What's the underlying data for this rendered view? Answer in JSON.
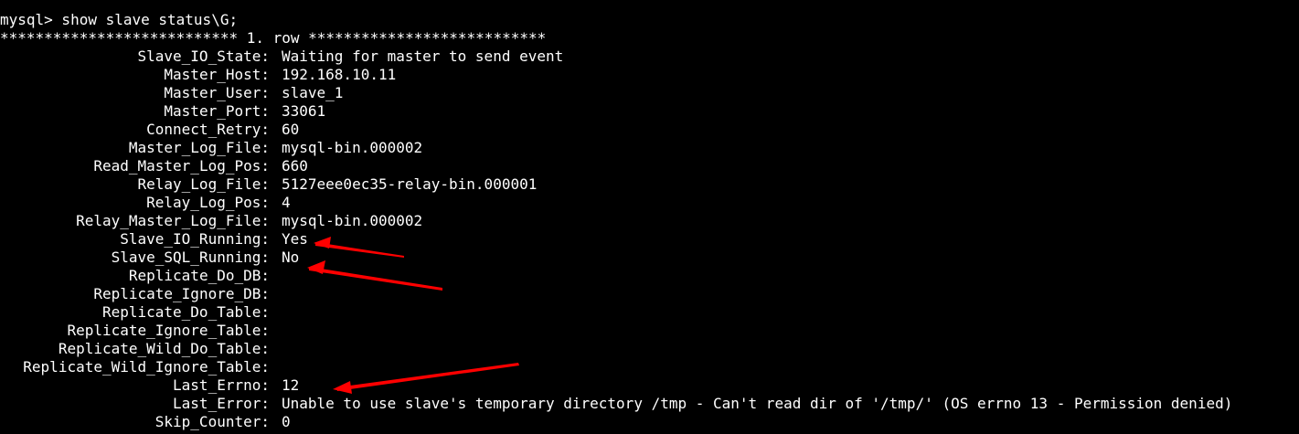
{
  "terminal": {
    "prompt_line": "mysql> show slave status\\G;",
    "row_header": "*************************** 1. row ***************************",
    "fields": [
      {
        "key": "Slave_IO_State:",
        "value": "Waiting for master to send event"
      },
      {
        "key": "Master_Host:",
        "value": "192.168.10.11"
      },
      {
        "key": "Master_User:",
        "value": "slave_1"
      },
      {
        "key": "Master_Port:",
        "value": "33061"
      },
      {
        "key": "Connect_Retry:",
        "value": "60"
      },
      {
        "key": "Master_Log_File:",
        "value": "mysql-bin.000002"
      },
      {
        "key": "Read_Master_Log_Pos:",
        "value": "660"
      },
      {
        "key": "Relay_Log_File:",
        "value": "5127eee0ec35-relay-bin.000001"
      },
      {
        "key": "Relay_Log_Pos:",
        "value": "4"
      },
      {
        "key": "Relay_Master_Log_File:",
        "value": "mysql-bin.000002"
      },
      {
        "key": "Slave_IO_Running:",
        "value": "Yes"
      },
      {
        "key": "Slave_SQL_Running:",
        "value": "No"
      },
      {
        "key": "Replicate_Do_DB:",
        "value": ""
      },
      {
        "key": "Replicate_Ignore_DB:",
        "value": ""
      },
      {
        "key": "Replicate_Do_Table:",
        "value": ""
      },
      {
        "key": "Replicate_Ignore_Table:",
        "value": ""
      },
      {
        "key": "Replicate_Wild_Do_Table:",
        "value": ""
      },
      {
        "key": "Replicate_Wild_Ignore_Table:",
        "value": ""
      },
      {
        "key": "Last_Errno:",
        "value": "12"
      },
      {
        "key": "Last_Error:",
        "value": "Unable to use slave's temporary directory /tmp - Can't read dir of '/tmp/' (OS errno 13 - Permission denied)"
      },
      {
        "key": "Skip_Counter:",
        "value": "0"
      }
    ]
  },
  "colors": {
    "background": "#000000",
    "text": "#ffffff",
    "annotation_arrow": "#ff0000"
  }
}
